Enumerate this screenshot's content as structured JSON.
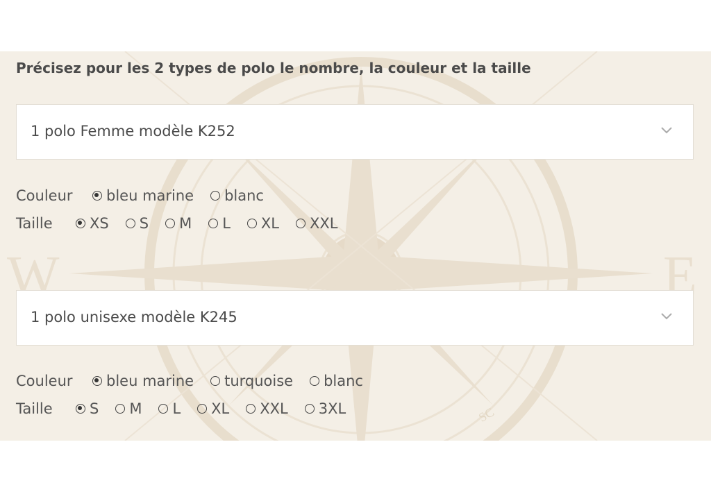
{
  "heading": "Précisez pour les 2 types de polo le nombre, la couleur et la taille",
  "items": [
    {
      "select_value": "1 polo Femme modèle K252",
      "couleur_label": "Couleur",
      "taille_label": "Taille",
      "couleurs": [
        {
          "label": "bleu marine",
          "checked": true
        },
        {
          "label": "blanc",
          "checked": false
        }
      ],
      "tailles": [
        {
          "label": "XS",
          "checked": true
        },
        {
          "label": "S",
          "checked": false
        },
        {
          "label": "M",
          "checked": false
        },
        {
          "label": "L",
          "checked": false
        },
        {
          "label": "XL",
          "checked": false
        },
        {
          "label": "XXL",
          "checked": false
        }
      ]
    },
    {
      "select_value": "1 polo unisexe modèle K245",
      "couleur_label": "Couleur",
      "taille_label": "Taille",
      "couleurs": [
        {
          "label": "bleu marine",
          "checked": true
        },
        {
          "label": "turquoise",
          "checked": false
        },
        {
          "label": "blanc",
          "checked": false
        }
      ],
      "tailles": [
        {
          "label": "S",
          "checked": true
        },
        {
          "label": "M",
          "checked": false
        },
        {
          "label": "L",
          "checked": false
        },
        {
          "label": "XL",
          "checked": false
        },
        {
          "label": "XXL",
          "checked": false
        },
        {
          "label": "3XL",
          "checked": false
        }
      ]
    }
  ],
  "background_letters": {
    "west": "W",
    "east": "E",
    "south_small": "SC"
  },
  "colors": {
    "panel": "#f4efe6",
    "compass": "#e7dccb",
    "text": "#555555"
  }
}
